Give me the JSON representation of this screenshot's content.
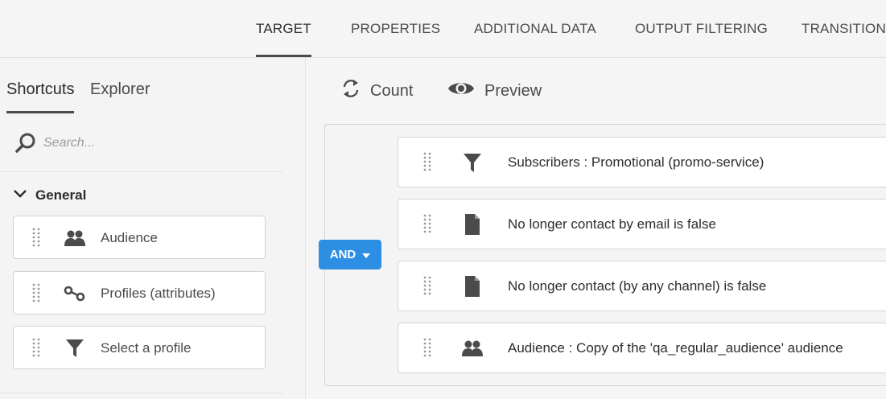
{
  "tabs": [
    {
      "label": "TARGET",
      "active": true
    },
    {
      "label": "PROPERTIES",
      "active": false
    },
    {
      "label": "ADDITIONAL DATA",
      "active": false
    },
    {
      "label": "OUTPUT FILTERING",
      "active": false
    },
    {
      "label": "TRANSITION",
      "active": false
    }
  ],
  "left_panel": {
    "tabs": [
      {
        "label": "Shortcuts",
        "active": true
      },
      {
        "label": "Explorer",
        "active": false
      }
    ],
    "search": {
      "placeholder": "Search...",
      "value": "",
      "icon": "search-icon"
    },
    "group": {
      "label": "General",
      "expanded": true,
      "icon": "chevron-down-icon"
    },
    "items": [
      {
        "label": "Audience",
        "icon": "audience-icon"
      },
      {
        "label": "Profiles (attributes)",
        "icon": "link-icon"
      },
      {
        "label": "Select a profile",
        "icon": "filter-icon"
      }
    ]
  },
  "toolbar": {
    "count_label": "Count",
    "count_icon": "refresh-icon",
    "preview_label": "Preview",
    "preview_icon": "eye-icon"
  },
  "operator": {
    "label": "AND",
    "icon": "caret-down-icon"
  },
  "rules": [
    {
      "label": "Subscribers : Promotional (promo-service)",
      "icon": "filter-icon"
    },
    {
      "label": "No longer contact by email is false",
      "icon": "document-icon"
    },
    {
      "label": "No longer contact (by any channel) is false",
      "icon": "document-icon"
    },
    {
      "label": "Audience : Copy of the 'qa_regular_audience' audience",
      "icon": "audience-icon"
    }
  ],
  "colors": {
    "accent": "#2d8fe3",
    "background": "#f5f5f5",
    "card": "#ffffff",
    "icon": "#4b4b4b"
  }
}
